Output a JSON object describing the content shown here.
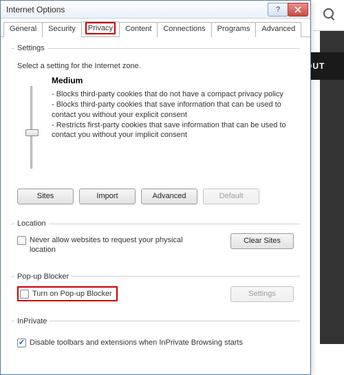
{
  "background": {
    "truncated_nav": "OUT"
  },
  "dialog": {
    "title": "Internet Options",
    "tabs": [
      "General",
      "Security",
      "Privacy",
      "Content",
      "Connections",
      "Programs",
      "Advanced"
    ],
    "active_tab_index": 2,
    "settings": {
      "legend": "Settings",
      "desc": "Select a setting for the Internet zone.",
      "level": "Medium",
      "bullets": "- Blocks third-party cookies that do not have a compact privacy policy\n- Blocks third-party cookies that save information that can be used to contact you without your explicit consent\n- Restricts first-party cookies that save information that can be used to contact you without your implicit consent",
      "buttons": {
        "sites": "Sites",
        "import": "Import",
        "advanced": "Advanced",
        "default": "Default"
      }
    },
    "location": {
      "legend": "Location",
      "never_allow": "Never allow websites to request your physical location",
      "clear_sites": "Clear Sites"
    },
    "popup": {
      "legend": "Pop-up Blocker",
      "turn_on": "Turn on Pop-up Blocker",
      "settings_btn": "Settings"
    },
    "inprivate": {
      "legend": "InPrivate",
      "disable_toolbars": "Disable toolbars and extensions when InPrivate Browsing starts"
    }
  }
}
